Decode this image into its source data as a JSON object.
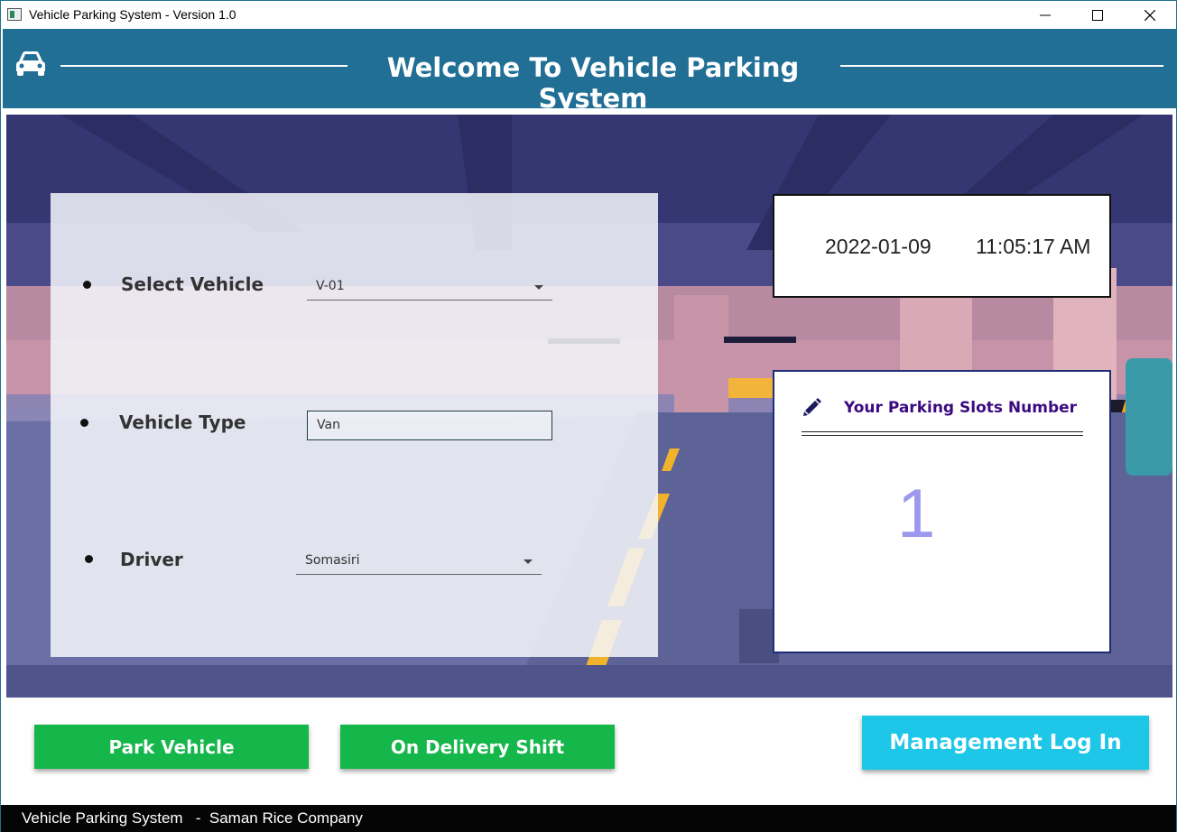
{
  "window": {
    "title": "Vehicle Parking System - Version 1.0",
    "controls": [
      "minimize",
      "maximize",
      "close"
    ]
  },
  "header": {
    "title": "Welcome To Vehicle Parking System",
    "icon": "car-icon",
    "background": "#226f96"
  },
  "form": {
    "select_vehicle": {
      "label": "Select Vehicle",
      "value": "V-01"
    },
    "vehicle_type": {
      "label": "Vehicle Type",
      "value": "Van"
    },
    "driver": {
      "label": "Driver",
      "value": "Somasiri"
    }
  },
  "clock": {
    "date": "2022-01-09",
    "time": "11:05:17 AM"
  },
  "slot": {
    "title": "Your Parking Slots Number",
    "icon": "pencil-icon",
    "number": "1"
  },
  "buttons": {
    "park": "Park Vehicle",
    "delivery": "On Delivery Shift",
    "management": "Management Log In"
  },
  "colors": {
    "button_green": "#15b64a",
    "button_cyan": "#1ec6e8",
    "slot_title": "#3b0a80",
    "slot_number": "#9b98ee"
  },
  "status_bar": {
    "text": "Vehicle Parking System   -  Saman Rice Company"
  }
}
